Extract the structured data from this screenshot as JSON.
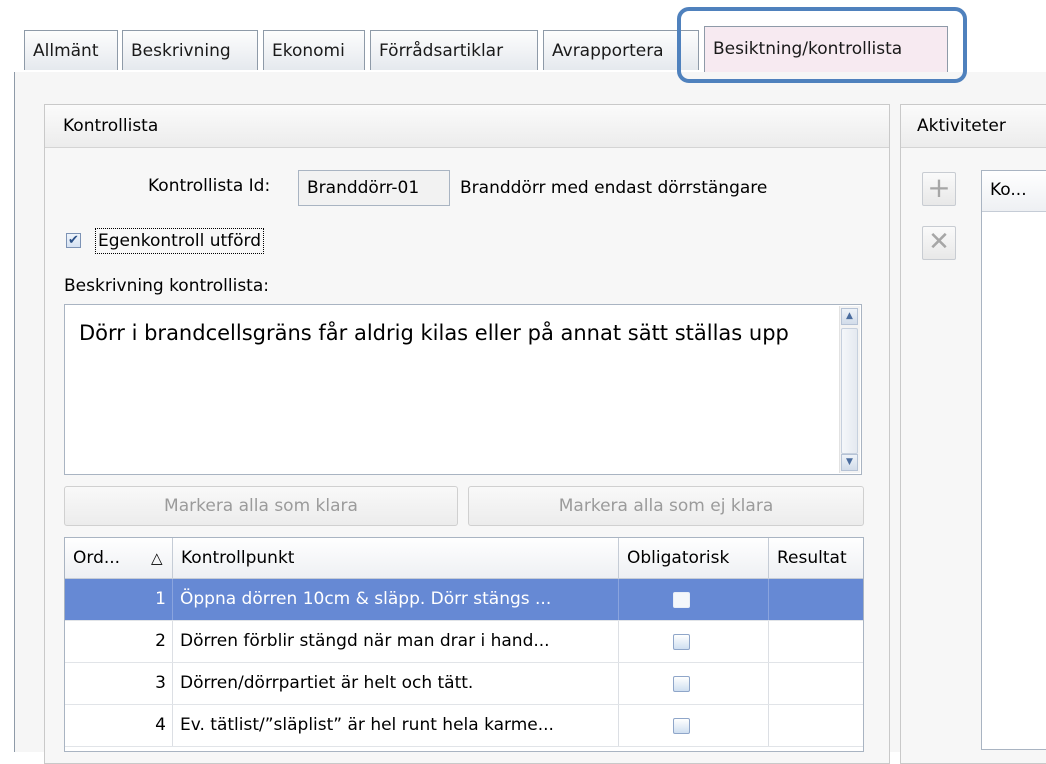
{
  "tabs": [
    {
      "label": "Allmänt"
    },
    {
      "label": "Beskrivning"
    },
    {
      "label": "Ekonomi"
    },
    {
      "label": "Förrådsartiklar"
    },
    {
      "label": "Avrapportera"
    },
    {
      "label": "Besiktning/kontrollista",
      "active": true
    }
  ],
  "kontrollista": {
    "title": "Kontrollista",
    "id_label": "Kontrollista Id:",
    "id_value": "Branddörr-01",
    "id_description": "Branddörr med endast dörrstängare",
    "egenkontroll_label": "Egenkontroll utförd",
    "egenkontroll_checked": true,
    "beskrivning_label": "Beskrivning kontrollista:",
    "beskrivning_text": "Dörr i brandcellsgräns får aldrig kilas eller på annat sätt ställas upp",
    "btn_mark_all": "Markera alla som klara",
    "btn_mark_none": "Markera alla som ej klara"
  },
  "grid": {
    "columns": [
      "Ord...",
      "Kontrollpunkt",
      "Obligatorisk",
      "Resultat"
    ],
    "sort_indicator": "△",
    "rows": [
      {
        "ord": "1",
        "kontrollpunkt": "Öppna dörren 10cm & släpp. Dörr stängs ...",
        "selected": true
      },
      {
        "ord": "2",
        "kontrollpunkt": "Dörren förblir stängd när man drar i hand..."
      },
      {
        "ord": "3",
        "kontrollpunkt": "Dörren/dörrpartiet är helt och tätt."
      },
      {
        "ord": "4",
        "kontrollpunkt": "Ev. tätlist/”släplist” är hel runt hela karme..."
      }
    ]
  },
  "aktiviteter": {
    "title": "Aktiviteter",
    "list_header": "Ko..."
  },
  "colors": {
    "highlight": "#4f81bd",
    "selected_row": "#6689d4",
    "active_tab": "#f7eaf1"
  }
}
